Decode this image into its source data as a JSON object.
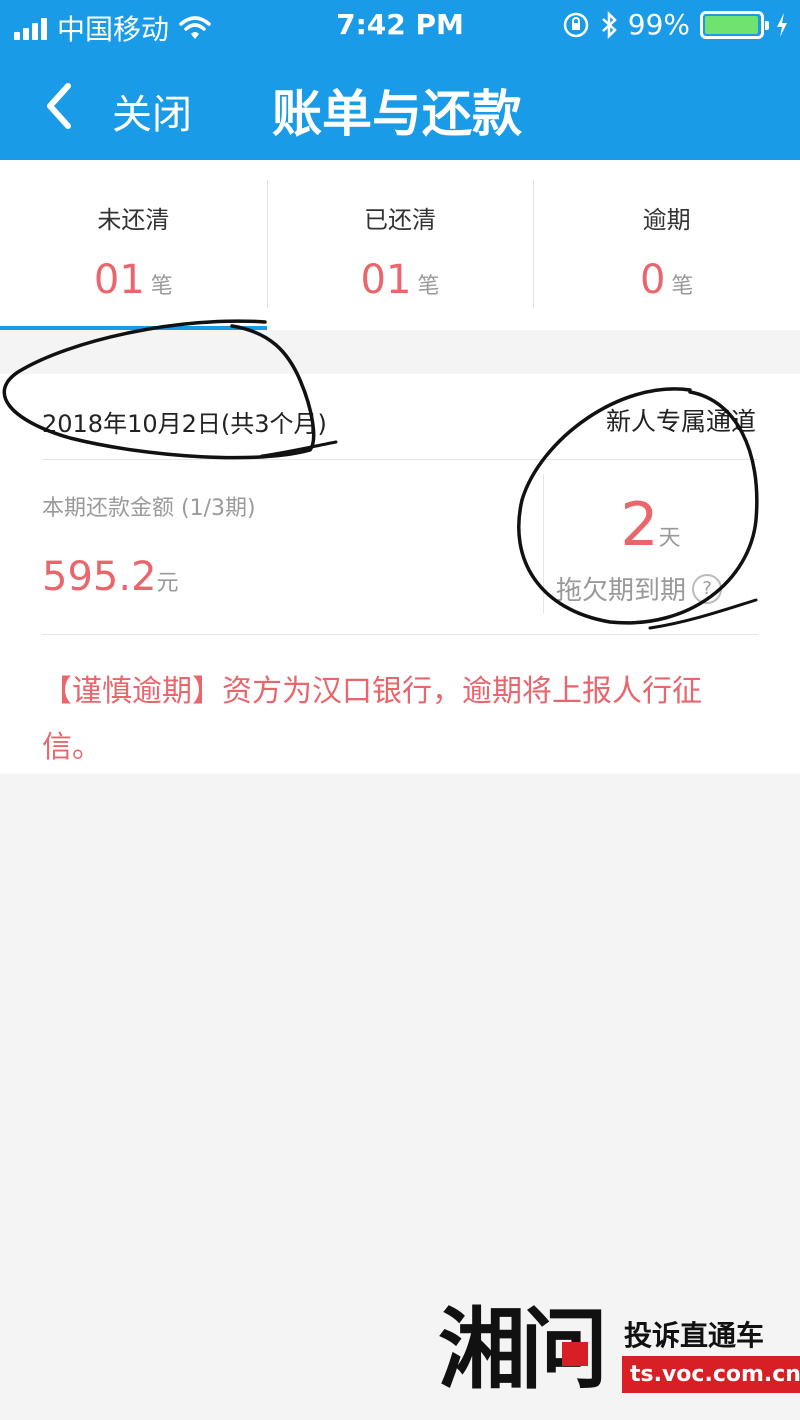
{
  "status_bar": {
    "carrier": "中国移动",
    "time": "7:42 PM",
    "battery_percent": "99%",
    "battery_level": 0.99
  },
  "nav": {
    "close_label": "关闭",
    "title": "账单与还款"
  },
  "tabs": [
    {
      "label": "未还清",
      "count": "01",
      "unit": "笔",
      "selected": true
    },
    {
      "label": "已还清",
      "count": "01",
      "unit": "笔",
      "selected": false
    },
    {
      "label": "逾期",
      "count": "0",
      "unit": "笔",
      "selected": false
    }
  ],
  "bill": {
    "date": "2018年10月2日(共3个月)",
    "new_channel": "新人专属通道",
    "amount_label": "本期还款金额 (1/3期)",
    "amount": "595.2",
    "amount_unit": "元",
    "days": "2",
    "days_unit": "天",
    "overdue_label": "拖欠期到期",
    "help": "?",
    "warning": "【谨慎逾期】资方为汉口银行，逾期将上报人行征信。"
  },
  "colors": {
    "header": "#1a9be8",
    "accent_red": "#e8666c",
    "background": "#f4f4f4"
  },
  "watermark": {
    "logo": "湘问",
    "slogan": "投诉直通车",
    "url": "ts.voc.com.cn"
  }
}
